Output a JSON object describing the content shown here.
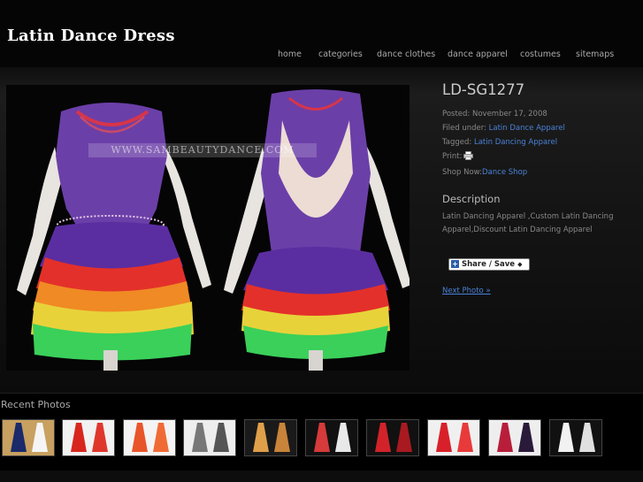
{
  "site": {
    "title": "Latin Dance Dress"
  },
  "nav": {
    "items": [
      {
        "label": "home"
      },
      {
        "label": "categories"
      },
      {
        "label": "dance clothes"
      },
      {
        "label": "dance apparel"
      },
      {
        "label": "costumes"
      },
      {
        "label": "sitemaps"
      }
    ]
  },
  "photo": {
    "watermark": "WWW.SAMBEAUTYDANCE.COM",
    "title": "LD-SG1277",
    "posted_label": "Posted:",
    "posted_date": "November 17, 2008",
    "filed_label": "Filed under:",
    "filed_link": "Latin Dance Apparel",
    "tagged_label": "Tagged:",
    "tagged_link": "Latin Dancing Apparel",
    "print_label": "Print:",
    "shop_label": "Shop Now:",
    "shop_link": "Dance Shop",
    "description_heading": "Description",
    "description_text": "Latin Dancing Apparel ,Custom Latin Dancing Apparel,Discount Latin Dancing Apparel",
    "share_label": "Share / Save",
    "next_label": "Next Photo »"
  },
  "recent": {
    "heading": "Recent Photos",
    "thumbs": [
      {
        "colors": [
          "#1a2a6a",
          "#f5f5f5"
        ],
        "bg": "#c8a060"
      },
      {
        "colors": [
          "#d8261f",
          "#e0372c"
        ],
        "bg": "#f2f2f2"
      },
      {
        "colors": [
          "#e8552a",
          "#f06a35"
        ],
        "bg": "#f4f4f4"
      },
      {
        "colors": [
          "#777777",
          "#555555"
        ],
        "bg": "#eeeeee"
      },
      {
        "colors": [
          "#e0a04a",
          "#c8843a"
        ],
        "bg": "#1a1a1a"
      },
      {
        "colors": [
          "#d63a3a",
          "#e8e8e8"
        ],
        "bg": "#111111"
      },
      {
        "colors": [
          "#d2232a",
          "#a81a20"
        ],
        "bg": "#111111"
      },
      {
        "colors": [
          "#d8202a",
          "#e83a3a"
        ],
        "bg": "#f0f0f0"
      },
      {
        "colors": [
          "#b81e3a",
          "#2a1a3a"
        ],
        "bg": "#eeeeee"
      },
      {
        "colors": [
          "#f2f2f2",
          "#e0e0e0"
        ],
        "bg": "#111111"
      }
    ]
  }
}
